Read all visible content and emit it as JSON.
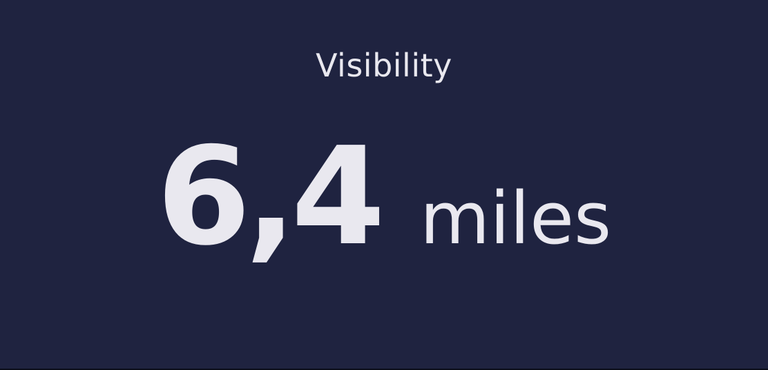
{
  "widget": {
    "title": "Visibility",
    "value": "6,4",
    "unit": "miles"
  },
  "colors": {
    "background": "#1f2340",
    "text": "#e9e8ef"
  }
}
